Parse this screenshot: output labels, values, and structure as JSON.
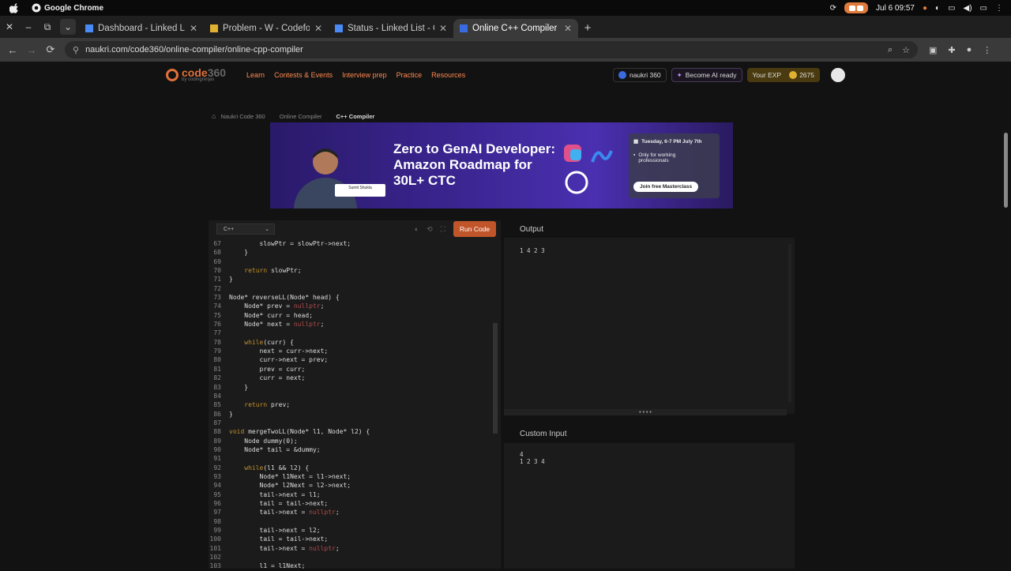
{
  "macbar": {
    "app_name": "Google Chrome",
    "date_time": "Jul 6  09:57"
  },
  "tabs": [
    {
      "label": "Dashboard - Linked Li",
      "active": false,
      "fav": "#4a8af4"
    },
    {
      "label": "Problem - W - Codefor",
      "active": false,
      "fav": "#e0b030"
    },
    {
      "label": "Status - Linked List - C",
      "active": false,
      "fav": "#4a8af4"
    },
    {
      "label": "Online C++ Compiler -",
      "active": true,
      "fav": "#3a6ae0"
    }
  ],
  "address": {
    "url": "naukri.com/code360/online-compiler/online-cpp-compiler"
  },
  "site": {
    "logo_text": "code",
    "logo_num": "360",
    "logo_sub": "by codingninjas",
    "nav": [
      "Learn",
      "Contests & Events",
      "Interview prep",
      "Practice",
      "Resources"
    ],
    "naukri_badge": "naukri 360",
    "ai_ready": "Become AI ready",
    "exp_label": "Your EXP",
    "exp_value": "2675"
  },
  "breadcrumb": [
    "Naukri Code 360",
    "Online Compiler",
    "C++ Compiler"
  ],
  "banner": {
    "headline_1": "Zero to GenAI Developer:",
    "headline_2": "Amazon Roadmap for",
    "headline_3": "30L+ CTC",
    "speaker": "Sumit Shukla",
    "date": "Tuesday, 6-7 PM July 7th",
    "audience": "Only for working professionals",
    "cta": "Join free Masterclass"
  },
  "editor": {
    "language": "C++",
    "run_label": "Run Code",
    "lines": [
      [
        "67",
        "        slowPtr = slowPtr->next;"
      ],
      [
        "68",
        "    }"
      ],
      [
        "69",
        ""
      ],
      [
        "70",
        "    return slowPtr;"
      ],
      [
        "71",
        "}"
      ],
      [
        "72",
        ""
      ],
      [
        "73",
        "Node* reverseLL(Node* head) {"
      ],
      [
        "74",
        "    Node* prev = nullptr;"
      ],
      [
        "75",
        "    Node* curr = head;"
      ],
      [
        "76",
        "    Node* next = nullptr;"
      ],
      [
        "77",
        ""
      ],
      [
        "78",
        "    while(curr) {"
      ],
      [
        "79",
        "        next = curr->next;"
      ],
      [
        "80",
        "        curr->next = prev;"
      ],
      [
        "81",
        "        prev = curr;"
      ],
      [
        "82",
        "        curr = next;"
      ],
      [
        "83",
        "    }"
      ],
      [
        "84",
        ""
      ],
      [
        "85",
        "    return prev;"
      ],
      [
        "86",
        "}"
      ],
      [
        "87",
        ""
      ],
      [
        "88",
        "void mergeTwoLL(Node* l1, Node* l2) {"
      ],
      [
        "89",
        "    Node dummy(0);"
      ],
      [
        "90",
        "    Node* tail = &dummy;"
      ],
      [
        "91",
        ""
      ],
      [
        "92",
        "    while(l1 && l2) {"
      ],
      [
        "93",
        "        Node* l1Next = l1->next;"
      ],
      [
        "94",
        "        Node* l2Next = l2->next;"
      ],
      [
        "95",
        "        tail->next = l1;"
      ],
      [
        "96",
        "        tail = tail->next;"
      ],
      [
        "97",
        "        tail->next = nullptr;"
      ],
      [
        "98",
        ""
      ],
      [
        "99",
        "        tail->next = l2;"
      ],
      [
        "100",
        "        tail = tail->next;"
      ],
      [
        "101",
        "        tail->next = nullptr;"
      ],
      [
        "102",
        ""
      ],
      [
        "103",
        "        l1 = l1Next;"
      ]
    ]
  },
  "output": {
    "title": "Output",
    "text": "1 4 2 3"
  },
  "custom_input": {
    "title": "Custom Input",
    "text": "4\n1 2 3 4"
  }
}
